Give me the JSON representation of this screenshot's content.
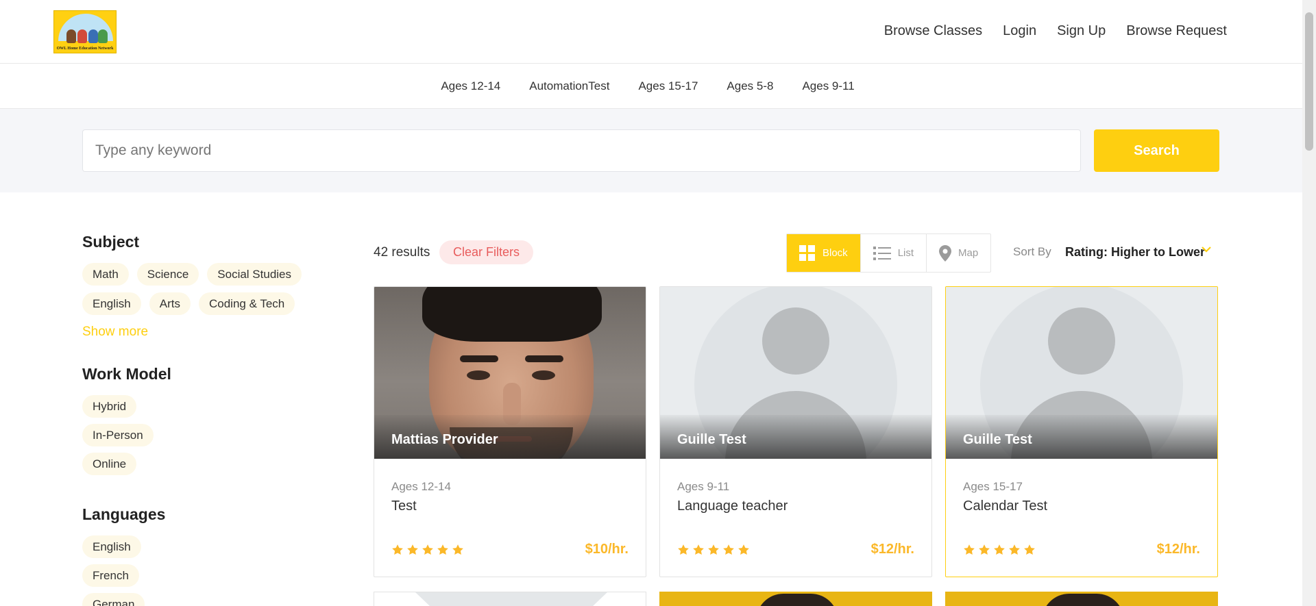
{
  "header": {
    "logo_caption": "OWL Home Education Network",
    "nav": [
      "Browse Classes",
      "Login",
      "Sign Up",
      "Browse Request"
    ]
  },
  "categories": [
    "Ages 12-14",
    "AutomationTest",
    "Ages 15-17",
    "Ages 5-8",
    "Ages 9-11"
  ],
  "search": {
    "placeholder": "Type any keyword",
    "button_label": "Search"
  },
  "sidebar": {
    "subject": {
      "title": "Subject",
      "items": [
        "Math",
        "Science",
        "Social Studies",
        "English",
        "Arts",
        "Coding & Tech"
      ],
      "show_more": "Show more"
    },
    "work_model": {
      "title": "Work Model",
      "items": [
        "Hybrid",
        "In-Person",
        "Online"
      ]
    },
    "languages": {
      "title": "Languages",
      "items": [
        "English",
        "French",
        "German"
      ]
    }
  },
  "results": {
    "count_label": "42 results",
    "clear_filters": "Clear Filters",
    "views": [
      "Block",
      "List",
      "Map"
    ],
    "active_view": "Block",
    "sort_label": "Sort By",
    "sort_value": "Rating: Higher to Lower"
  },
  "cards": [
    {
      "provider": "Mattias Provider",
      "age": "Ages 12-14",
      "title": "Test",
      "rating": 5,
      "price": "$10/hr.",
      "photo": "portrait"
    },
    {
      "provider": "Guille Test",
      "age": "Ages 9-11",
      "title": "Language teacher",
      "rating": 5,
      "price": "$12/hr.",
      "photo": "placeholder-avatar"
    },
    {
      "provider": "Guille Test",
      "age": "Ages 15-17",
      "title": "Calendar Test",
      "rating": 5,
      "price": "$12/hr.",
      "photo": "placeholder-avatar"
    }
  ],
  "colors": {
    "accent": "#fecf10",
    "price": "#fbb829",
    "clear_filters_bg": "#fde9e9",
    "clear_filters_text": "#e85c5c",
    "chip_bg": "#fdf8e7"
  }
}
